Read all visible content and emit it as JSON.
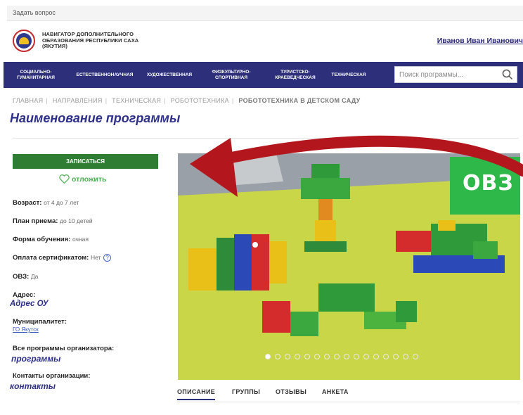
{
  "topbar": {
    "ask_question": "Задать вопрос"
  },
  "header": {
    "brand_line1": "НАВИГАТОР ДОПОЛНИТЕЛЬНОГО",
    "brand_line2": "ОБРАЗОВАНИЯ РЕСПУБЛИКИ САХА",
    "brand_line3": "(ЯКУТИЯ)",
    "user_name": "Иванов Иван Иванович"
  },
  "nav": {
    "items": [
      {
        "line1": "СОЦИАЛЬНО-",
        "line2": "ГУМАНИТАРНАЯ"
      },
      {
        "line1": "ЕСТЕСТВЕННОНАУЧНАЯ",
        "line2": ""
      },
      {
        "line1": "ХУДОЖЕСТВЕННАЯ",
        "line2": ""
      },
      {
        "line1": "ФИЗКУЛЬТУРНО-",
        "line2": "СПОРТИВНАЯ"
      },
      {
        "line1": "ТУРИСТСКО-",
        "line2": "КРАЕВЕДЧЕСКАЯ"
      },
      {
        "line1": "ТЕХНИЧЕСКАЯ",
        "line2": ""
      }
    ],
    "search_placeholder": "Поиск программы...",
    "colors": {
      "nav_bg": "#2d2f7a",
      "accent_green": "#2e7d32"
    }
  },
  "breadcrumb": [
    "ГЛАВНАЯ",
    "НАПРАВЛЕНИЯ",
    "ТЕХНИЧЕСКАЯ",
    "РОБОТОТЕХНИКА",
    "РОБОТОТЕХНИКА В ДЕТСКОМ САДУ"
  ],
  "page_title": "Наименование программы",
  "actions": {
    "enroll": "ЗАПИСАТЬСЯ",
    "postpone": "отложить"
  },
  "info": {
    "age_label": "Возраст:",
    "age_value": "от 4 до 7 лет",
    "intake_label": "План приема:",
    "intake_value": "до 10 детей",
    "form_label": "Форма обучения:",
    "form_value": "очная",
    "cert_label": "Оплата сертификатом:",
    "cert_value": "Нет",
    "ovz_label": "ОВЗ:",
    "ovz_value": "Да",
    "address_label": "Адрес:",
    "address_value": "Адрес ОУ",
    "muni_label": "Муниципалитет:",
    "muni_value": "ГО Якутск",
    "all_programs_label": "Все программы организатора:",
    "all_programs_link": "программы",
    "contacts_label": "Контакты организации:",
    "contacts_link": "контакты"
  },
  "gallery": {
    "badge": "ОВЗ",
    "dot_count": 16,
    "active_dot": 1
  },
  "tabs": [
    "ОПИСАНИЕ",
    "ГРУППЫ",
    "ОТЗЫВЫ",
    "АНКЕТА"
  ]
}
